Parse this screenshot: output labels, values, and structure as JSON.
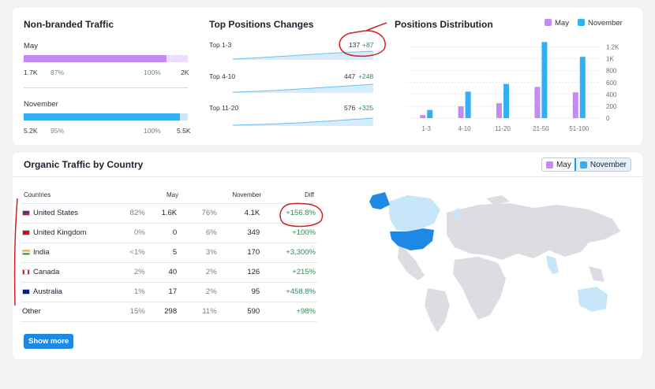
{
  "non_branded": {
    "title": "Non-branded Traffic",
    "may": {
      "label": "May",
      "value": "1.7K",
      "pct": "87%",
      "full": "100%",
      "max": "2K",
      "fill": 0.87,
      "color": "#c38cf5",
      "track": "#ecdcfd"
    },
    "november": {
      "label": "November",
      "value": "5.2K",
      "pct": "95%",
      "full": "100%",
      "max": "5.5K",
      "fill": 0.95,
      "color": "#33b0f5",
      "track": "#cbe8fb"
    }
  },
  "top_positions": {
    "title": "Top Positions Changes",
    "rows": [
      {
        "label": "Top 1-3",
        "value": "137",
        "delta": "+87"
      },
      {
        "label": "Top 4-10",
        "value": "447",
        "delta": "+248"
      },
      {
        "label": "Top 11-20",
        "value": "576",
        "delta": "+325"
      }
    ]
  },
  "distribution": {
    "title": "Positions Distribution",
    "legend": [
      {
        "name": "May",
        "color": "#c38cf5"
      },
      {
        "name": "November",
        "color": "#33b0f5"
      }
    ]
  },
  "chart_data": {
    "type": "bar",
    "title": "Positions Distribution",
    "categories": [
      "1-3",
      "4-10",
      "11-20",
      "21-50",
      "51-100"
    ],
    "series": [
      {
        "name": "May",
        "values": [
          50,
          199,
          251,
          527,
          434
        ]
      },
      {
        "name": "November",
        "values": [
          137,
          447,
          576,
          1282,
          1032
        ]
      }
    ],
    "yticks": [
      "0",
      "200",
      "400",
      "600",
      "800",
      "1K",
      "1.2K"
    ],
    "ylim": [
      0,
      1300
    ],
    "grid": true,
    "legend": "top-right"
  },
  "country": {
    "title": "Organic Traffic by Country",
    "toggle": {
      "may": "May",
      "november": "November"
    },
    "headers": {
      "countries": "Countries",
      "may": "May",
      "november": "November",
      "diff": "Diff"
    },
    "rows": [
      {
        "name": "United States",
        "may_pct": "82%",
        "may": "1.6K",
        "nov_pct": "76%",
        "nov": "4.1K",
        "diff": "+156.8%",
        "flag": "us"
      },
      {
        "name": "United Kingdom",
        "may_pct": "0%",
        "may": "0",
        "nov_pct": "6%",
        "nov": "349",
        "diff": "+100%",
        "flag": "uk"
      },
      {
        "name": "India",
        "may_pct": "<1%",
        "may": "5",
        "nov_pct": "3%",
        "nov": "170",
        "diff": "+3,300%",
        "flag": "in"
      },
      {
        "name": "Canada",
        "may_pct": "2%",
        "may": "40",
        "nov_pct": "2%",
        "nov": "126",
        "diff": "+215%",
        "flag": "ca"
      },
      {
        "name": "Australia",
        "may_pct": "1%",
        "may": "17",
        "nov_pct": "2%",
        "nov": "95",
        "diff": "+458.8%",
        "flag": "au"
      },
      {
        "name": "Other",
        "may_pct": "15%",
        "may": "298",
        "nov_pct": "11%",
        "nov": "590",
        "diff": "+98%",
        "flag": ""
      }
    ],
    "show_more": "Show more"
  }
}
